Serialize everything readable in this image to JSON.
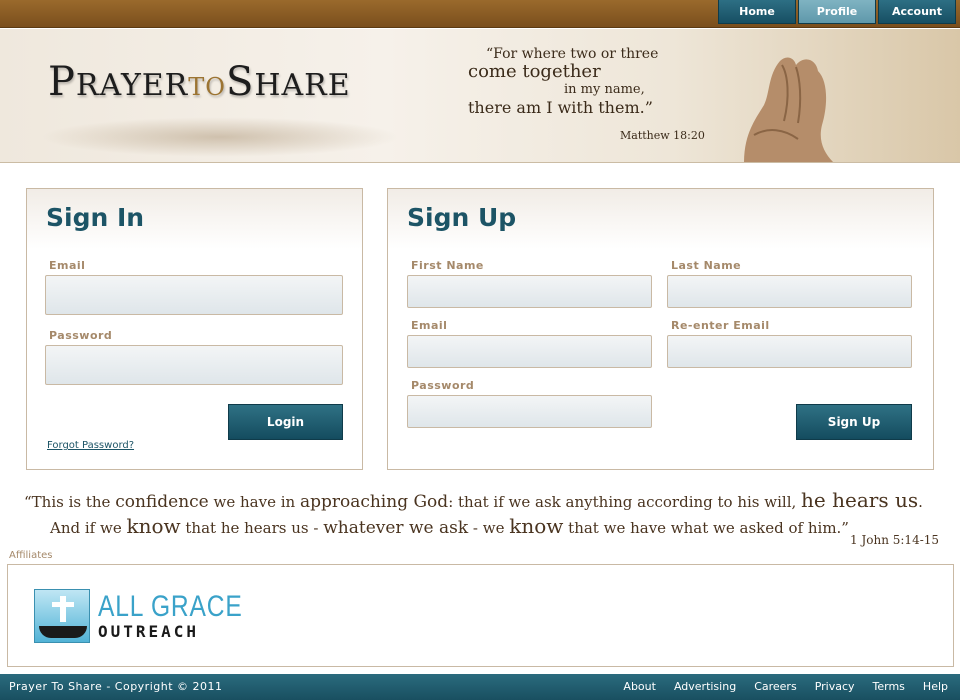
{
  "top_nav": {
    "items": [
      "Home",
      "Profile",
      "Account"
    ],
    "active": "Profile"
  },
  "banner": {
    "logo_prayer_p": "P",
    "logo_prayer_rest": "RAYER",
    "logo_to": "TO",
    "logo_share_s": "S",
    "logo_share_rest": "HARE",
    "quote_line1": "“For where two or three",
    "quote_line2": "come together",
    "quote_line3": "in my name,",
    "quote_line4": "there am I with them.”",
    "quote_ref": "Matthew 18:20"
  },
  "sign_in": {
    "title": "Sign In",
    "email_label": "Email",
    "password_label": "Password",
    "login_button": "Login",
    "forgot_link": "Forgot Password?"
  },
  "sign_up": {
    "title": "Sign Up",
    "first_name_label": "First Name",
    "last_name_label": "Last Name",
    "email_label": "Email",
    "reenter_email_label": "Re-enter Email",
    "password_label": "Password",
    "signup_button": "Sign Up"
  },
  "verse": {
    "l1a": "“This is the ",
    "l1b": "confidence",
    "l1c": " we have in ",
    "l1d": "approaching God",
    "l1e": ": that if we ask ",
    "l1f": "anything according to",
    "l1g": " his will, ",
    "l1h": "he hears us",
    "l1i": ".",
    "l2a": "And if we ",
    "l2b": "know",
    "l2c": " that he hears us - ",
    "l2d": "whatever we ask",
    "l2e": " - we ",
    "l2f": "know",
    "l2g": " that we have what we asked of him.”",
    "ref": "1 John 5:14-15"
  },
  "affiliates": {
    "label": "Affiliates",
    "logo_line1": "ALL GRACE",
    "logo_line2": "OUTREACH"
  },
  "footer": {
    "copyright": "Prayer To Share - Copyright © 2011",
    "links": [
      "About",
      "Advertising",
      "Careers",
      "Privacy",
      "Terms",
      "Help"
    ]
  }
}
